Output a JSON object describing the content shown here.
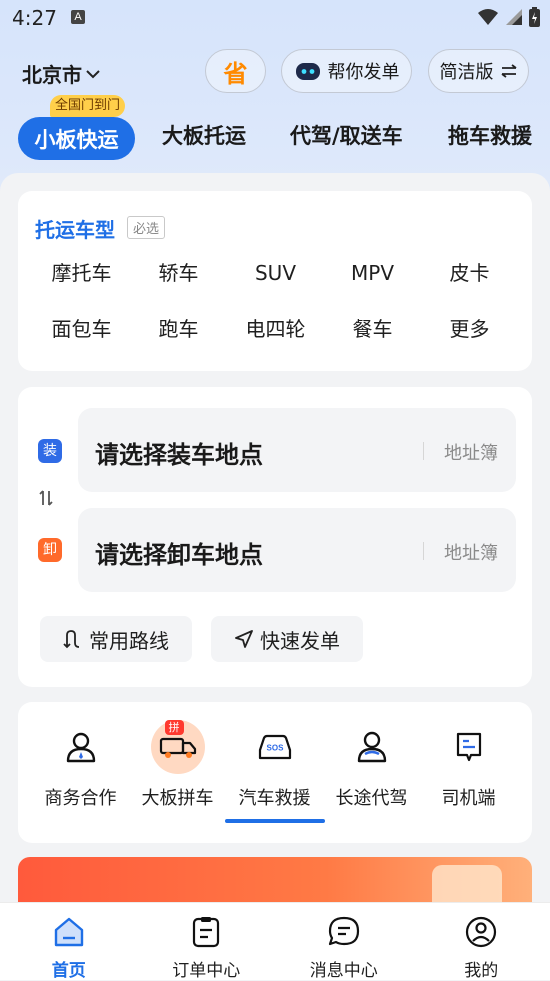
{
  "status_bar": {
    "time": "4:27",
    "notif": "A"
  },
  "header": {
    "city": "北京市",
    "save_glyph": "省",
    "help_label": "帮你发单",
    "simple_label": "简洁版"
  },
  "tabs": {
    "badge": "全国门到门",
    "items": [
      {
        "label": "小板快运"
      },
      {
        "label": "大板托运"
      },
      {
        "label": "代驾/取送车"
      },
      {
        "label": "拖车救援"
      }
    ]
  },
  "vehicle_type": {
    "title": "托运车型",
    "required_tag": "必选",
    "items": [
      "摩托车",
      "轿车",
      "SUV",
      "MPV",
      "皮卡",
      "面包车",
      "跑车",
      "电四轮",
      "餐车",
      "更多"
    ]
  },
  "address": {
    "load_icon": "装",
    "load_placeholder": "请选择装车地点",
    "unload_icon": "卸",
    "unload_placeholder": "请选择卸车地点",
    "address_book": "地址簿",
    "common_routes": "常用路线",
    "quick_order": "快速发单"
  },
  "services": {
    "pin_badge": "拼",
    "items": [
      {
        "label": "商务合作",
        "icon": "person-icon"
      },
      {
        "label": "大板拼车",
        "icon": "truck-icon"
      },
      {
        "label": "汽车救援",
        "icon": "sos-car-icon"
      },
      {
        "label": "长途代驾",
        "icon": "driver-icon"
      },
      {
        "label": "司机端",
        "icon": "document-icon"
      }
    ]
  },
  "bottom_nav": {
    "items": [
      {
        "label": "首页",
        "active": true
      },
      {
        "label": "订单中心"
      },
      {
        "label": "消息中心"
      },
      {
        "label": "我的"
      }
    ]
  },
  "colors": {
    "primary": "#1f6fe6",
    "accent_orange": "#ff8a00",
    "unload_orange": "#ff6a2b"
  }
}
